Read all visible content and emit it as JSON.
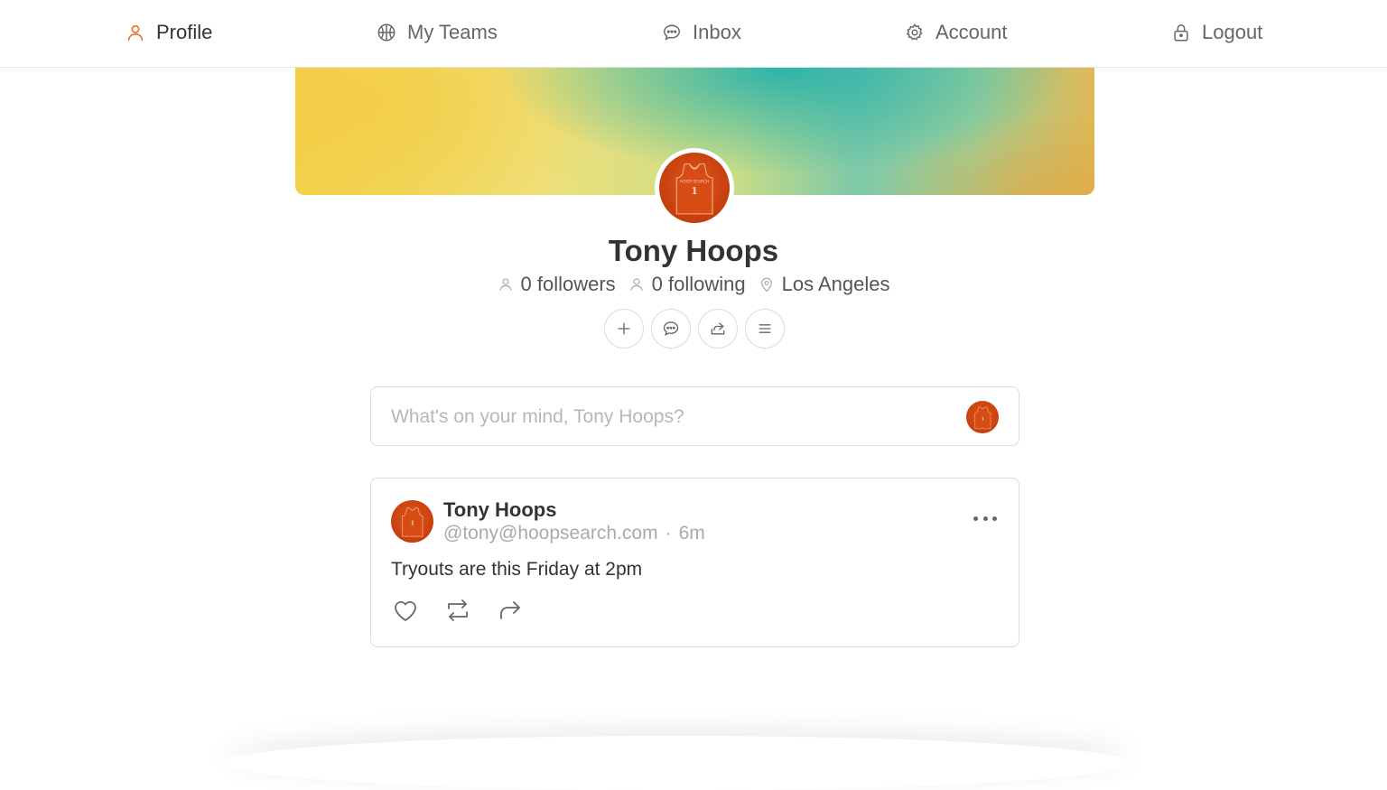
{
  "nav": {
    "items": [
      {
        "label": "Profile",
        "icon": "user-icon"
      },
      {
        "label": "My Teams",
        "icon": "basketball-icon"
      },
      {
        "label": "Inbox",
        "icon": "chat-icon"
      },
      {
        "label": "Account",
        "icon": "gear-icon"
      },
      {
        "label": "Logout",
        "icon": "lock-icon"
      }
    ],
    "active": "Profile",
    "accent_color": "#e8722c"
  },
  "profile": {
    "name": "Tony Hoops",
    "followers": "0 followers",
    "following": "0 following",
    "location": "Los Angeles",
    "actions": [
      "plus-icon",
      "chat-icon",
      "share-icon",
      "menu-icon"
    ]
  },
  "composer": {
    "placeholder": "What's on your mind, Tony Hoops?"
  },
  "post": {
    "author": "Tony Hoops",
    "handle": "@tony@hoopsearch.com",
    "separator": "·",
    "time": "6m",
    "body": "Tryouts are this Friday at 2pm",
    "actions": [
      "heart-icon",
      "repost-icon",
      "reply-icon"
    ]
  },
  "colors": {
    "jersey": "#c9410d",
    "muted": "#a9a9b3",
    "border": "#dcdcdc"
  }
}
